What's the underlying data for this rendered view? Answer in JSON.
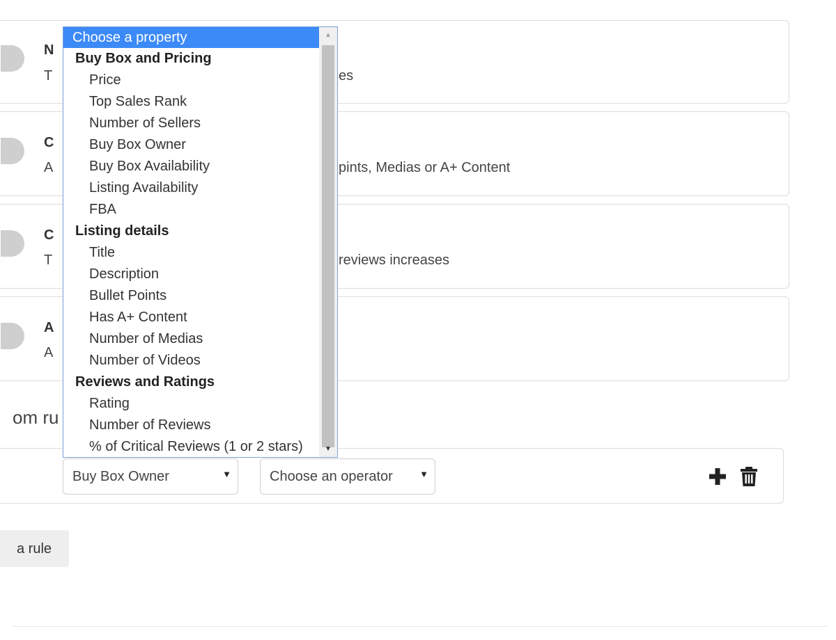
{
  "cards": [
    {
      "title": "N",
      "desc": "T",
      "desc_tail": "es"
    },
    {
      "title": "C",
      "desc": "A",
      "desc_tail": "pints, Medias or A+ Content"
    },
    {
      "title": "C",
      "desc": "T",
      "desc_tail": "reviews increases"
    },
    {
      "title": "A",
      "desc": "A",
      "desc_tail": ""
    }
  ],
  "section_title": "om ru",
  "rule": {
    "property_value": "Buy Box Owner",
    "operator_placeholder": "Choose an operator",
    "add_icon": "plus-icon",
    "delete_icon": "trash-icon"
  },
  "add_rule_label": "a rule",
  "dropdown": {
    "placeholder": "Choose a property",
    "groups": [
      {
        "label": "Buy Box and Pricing",
        "options": [
          "Price",
          "Top Sales Rank",
          "Number of Sellers",
          "Buy Box Owner",
          "Buy Box Availability",
          "Listing Availability",
          "FBA"
        ]
      },
      {
        "label": "Listing details",
        "options": [
          "Title",
          "Description",
          "Bullet Points",
          "Has A+ Content",
          "Number of Medias",
          "Number of Videos"
        ]
      },
      {
        "label": "Reviews and Ratings",
        "options": [
          "Rating",
          "Number of Reviews",
          "% of Critical Reviews (1 or 2 stars)"
        ]
      }
    ]
  },
  "colors": {
    "highlight": "#3c8af7",
    "toggle": "#cfcfcf",
    "border": "#dcdcdc"
  }
}
